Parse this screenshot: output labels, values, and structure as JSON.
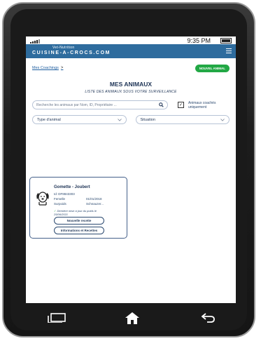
{
  "status": {
    "time": "9:35 PM"
  },
  "app": {
    "brand_top": "Vet-Nutrition",
    "brand_main": "CUISINE-A-CROCS.COM"
  },
  "breadcrumb": {
    "label": "Mes Coachings",
    "separator": ">"
  },
  "actions": {
    "new_animal": "NOUVEL ANIMAL"
  },
  "page": {
    "title": "MES ANIMAUX",
    "subtitle": "LISTE DES ANIMAUX SOUS VOTRE SURVEILLANCE"
  },
  "search": {
    "placeholder": "Recherche les animaux par Nom, ID, Propriétaire ..."
  },
  "filters": {
    "coached_only_label_1": "Animaux coachés",
    "coached_only_label_2": "uniquement",
    "coached_only_checked": true,
    "type_select": "Type d'animal",
    "situation_select": "Situation"
  },
  "animal_card": {
    "name": "Gomette - Joubert",
    "id_label": "Id: DF8843303",
    "sex": "Femelle",
    "birthdate": "01/01/2018",
    "condition": "Surpoids",
    "breed": "Schnauzer...",
    "update_line1": "Dernière mise à jour du poids le",
    "update_date": "25/06/2021",
    "btn_new_recipe": "Nouvelle recette",
    "btn_info": "Informations et Recettes"
  },
  "icons": {
    "search": "search-icon",
    "menu": "hamburger-menu-icon",
    "dog": "dog-icon",
    "recent": "recent-apps-icon",
    "home": "home-icon",
    "back": "back-icon"
  }
}
